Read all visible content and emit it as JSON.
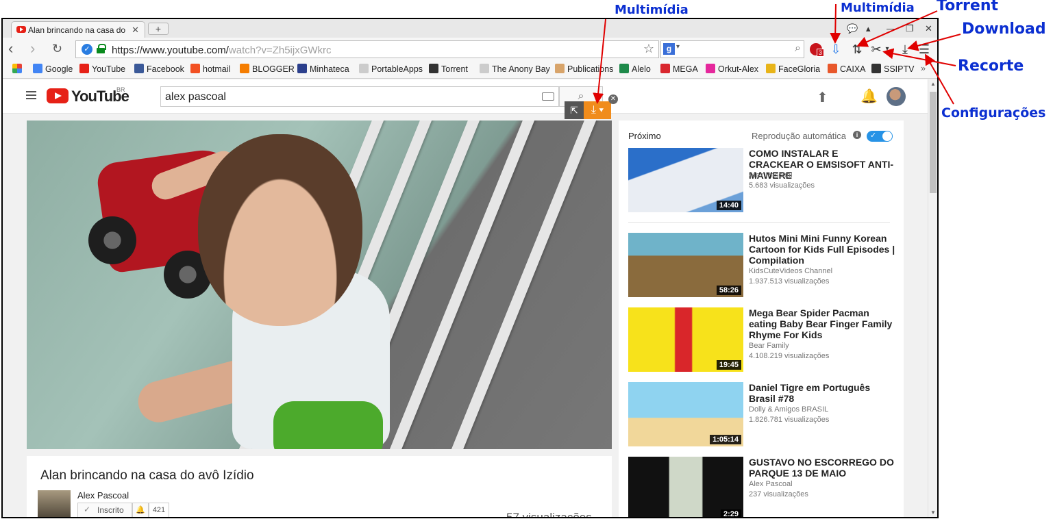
{
  "browser": {
    "tab_title": "Alan brincando na casa do",
    "tab_close": "✕",
    "new_tab": "+",
    "url_prefix": "https://www.youtube.com/",
    "url_rest": "watch?v=Zh5ijxGWkrc",
    "badge_count": "3"
  },
  "bookmarks": [
    {
      "label": "Google",
      "color": "#4285f4"
    },
    {
      "label": "YouTube",
      "color": "#e62117"
    },
    {
      "label": "Facebook",
      "color": "#3b5998"
    },
    {
      "label": "hotmail",
      "color": "#f25022"
    },
    {
      "label": "BLOGGER",
      "color": "#f57d00"
    },
    {
      "label": "Minhateca",
      "color": "#2b3f8c"
    },
    {
      "label": "PortableApps",
      "color": "#cccccc"
    },
    {
      "label": "Torrent",
      "color": "#333333"
    },
    {
      "label": "The Anony Bay",
      "color": "#cccccc"
    },
    {
      "label": "Publications",
      "color": "#d8a46a"
    },
    {
      "label": "Alelo",
      "color": "#1e8a4a"
    },
    {
      "label": "MEGA",
      "color": "#d9272e"
    },
    {
      "label": "Orkut-Alex",
      "color": "#e5279c"
    },
    {
      "label": "FaceGloria",
      "color": "#e8b418"
    },
    {
      "label": "CAIXA",
      "color": "#e8572b"
    },
    {
      "label": "SSIPTV",
      "color": "#333333"
    }
  ],
  "youtube": {
    "logo_text": "YouTube",
    "country": "BR",
    "search_value": "alex pascoal",
    "video_title": "Alan brincando na casa do avô Izídio",
    "channel": "Alex Pascoal",
    "subscribe_label": "Inscrito",
    "subscriber_count": "421",
    "views_partial": "57 visualizações"
  },
  "sidebar": {
    "next_label": "Próximo",
    "autoplay_label": "Reprodução automática",
    "items": [
      {
        "title": "COMO INSTALAR E CRACKEAR O EMSISOFT ANTI-MAWERE",
        "channel": "Alex Pascoal",
        "views": "5.683 visualizações",
        "duration": "14:40"
      },
      {
        "title": "Hutos Mini Mini Funny Korean Cartoon for Kids Full Episodes | Compilation",
        "channel": "KidsCuteVideos Channel",
        "views": "1.937.513 visualizações",
        "duration": "58:26"
      },
      {
        "title": "Mega Bear Spider Pacman eating Baby Bear Finger Family Rhyme For Kids",
        "channel": "Bear Family",
        "views": "4.108.219 visualizações",
        "duration": "19:45"
      },
      {
        "title": "Daniel Tigre em Português Brasil #78",
        "channel": "Dolly & Amigos BRASIL",
        "views": "1.826.781 visualizações",
        "duration": "1:05:14"
      },
      {
        "title": "GUSTAVO NO ESCORREGO DO PARQUE 13 DE MAIO",
        "channel": "Alex Pascoal",
        "views": "237 visualizações",
        "duration": "2:29"
      }
    ]
  },
  "annotations": {
    "multimidia_page": "Multimídia",
    "multimidia_ext": "Multimídia",
    "torrent": "Torrent",
    "download": "Download",
    "recorte": "Recorte",
    "configuracoes": "Configurações",
    "color": "#0b2fd1",
    "arrow_color": "#e00000"
  }
}
